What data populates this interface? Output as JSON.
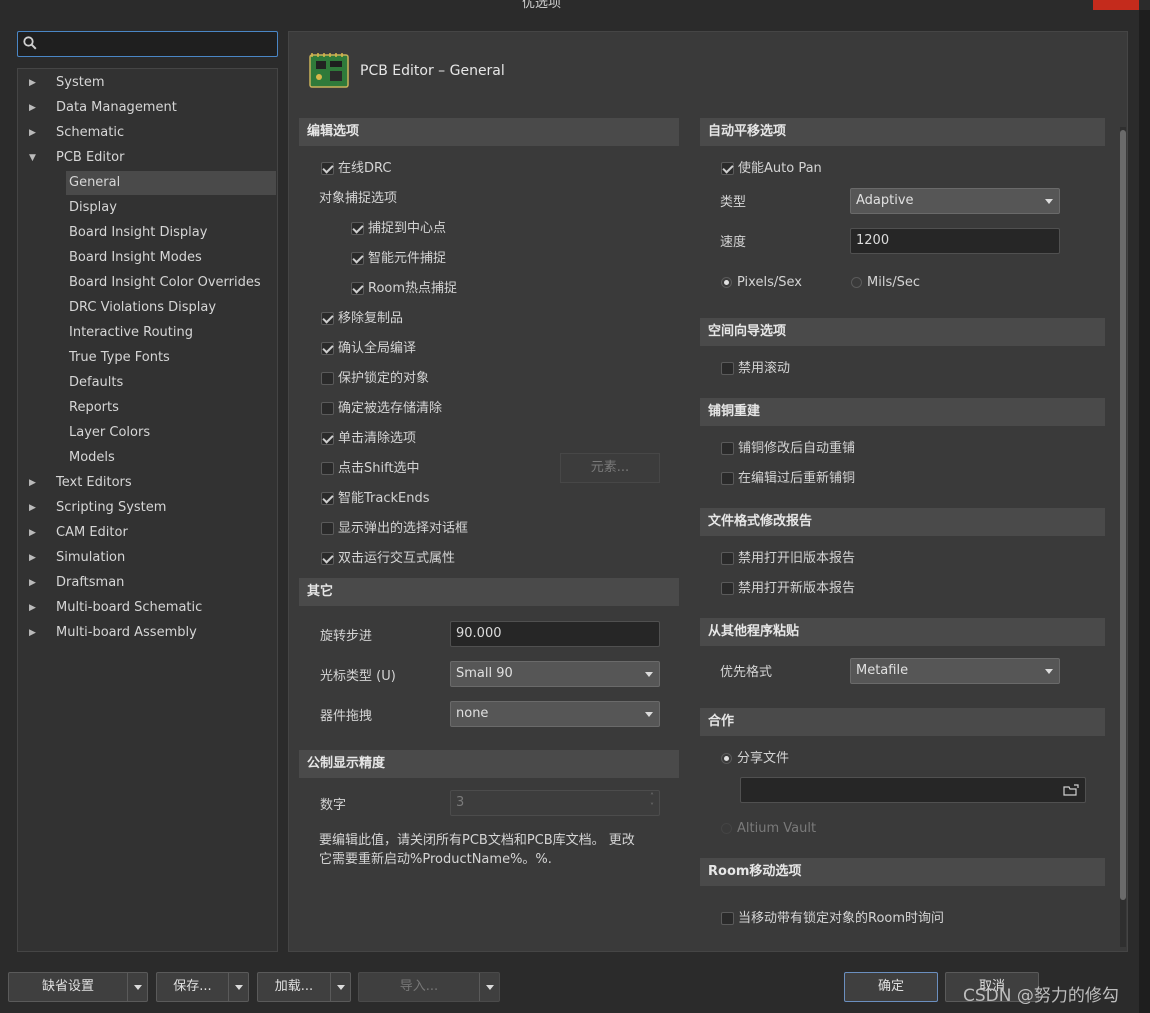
{
  "window": {
    "title": "优选项"
  },
  "search": {
    "placeholder": "",
    "value": ""
  },
  "tree": {
    "items": [
      {
        "label": "System"
      },
      {
        "label": "Data Management"
      },
      {
        "label": "Schematic"
      },
      {
        "label": "PCB Editor",
        "expanded": true
      }
    ],
    "pcb_children": [
      {
        "label": "General",
        "selected": true
      },
      {
        "label": "Display"
      },
      {
        "label": "Board Insight Display"
      },
      {
        "label": "Board Insight Modes"
      },
      {
        "label": "Board Insight Color Overrides"
      },
      {
        "label": "DRC Violations Display"
      },
      {
        "label": "Interactive Routing"
      },
      {
        "label": "True Type Fonts"
      },
      {
        "label": "Defaults"
      },
      {
        "label": "Reports"
      },
      {
        "label": "Layer Colors"
      },
      {
        "label": "Models"
      }
    ],
    "after_items": [
      {
        "label": "Text Editors"
      },
      {
        "label": "Scripting System"
      },
      {
        "label": "CAM Editor"
      },
      {
        "label": "Simulation"
      },
      {
        "label": "Draftsman"
      },
      {
        "label": "Multi-board Schematic"
      },
      {
        "label": "Multi-board Assembly"
      }
    ]
  },
  "page": {
    "title": "PCB Editor – General"
  },
  "edit_options": {
    "header": "编辑选项",
    "online_drc": {
      "label": "在线DRC",
      "checked": true
    },
    "snap_group_label": "对象捕捉选项",
    "snap_center": {
      "label": "捕捉到中心点",
      "checked": true
    },
    "smart_comp_snap": {
      "label": "智能元件捕捉",
      "checked": true
    },
    "room_hotspot": {
      "label": "Room热点捕捉",
      "checked": true
    },
    "remove_duplicates": {
      "label": "移除复制品",
      "checked": true
    },
    "confirm_global_edit": {
      "label": "确认全局编译",
      "checked": true
    },
    "protect_locked": {
      "label": "保护锁定的对象",
      "checked": false
    },
    "confirm_clear_memory": {
      "label": "确定被选存储清除",
      "checked": false
    },
    "click_clear_selection": {
      "label": "单击清除选项",
      "checked": true
    },
    "shift_click_select": {
      "label": "点击Shift选中",
      "checked": false
    },
    "elements_button": "元素...",
    "smart_track_ends": {
      "label": "智能TrackEnds",
      "checked": true
    },
    "show_popup_select": {
      "label": "显示弹出的选择对话框",
      "checked": false
    },
    "dblclick_inspector": {
      "label": "双击运行交互式属性",
      "checked": true
    }
  },
  "other": {
    "header": "其它",
    "rotation_step_label": "旋转步进",
    "rotation_step_value": "90.000",
    "cursor_type_label": "光标类型 (U)",
    "cursor_type_value": "Small 90",
    "comp_drag_label": "器件拖拽",
    "comp_drag_value": "none"
  },
  "metric_precision": {
    "header": "公制显示精度",
    "digits_label": "数字",
    "digits_value": "3",
    "note_line1": "要编辑此值，请关闭所有PCB文档和PCB库文档。 更改",
    "note_line2": "它需要重新启动%ProductName%。%."
  },
  "autopan": {
    "header": "自动平移选项",
    "enable": {
      "label": "使能Auto Pan",
      "checked": true
    },
    "type_label": "类型",
    "type_value": "Adaptive",
    "speed_label": "速度",
    "speed_value": "1200",
    "unit_pixels": {
      "label": "Pixels/Sex",
      "selected": true
    },
    "unit_mils": {
      "label": "Mils/Sec",
      "selected": false
    }
  },
  "space_nav": {
    "header": "空间向导选项",
    "disable_roll": {
      "label": "禁用滚动",
      "checked": false
    }
  },
  "polygon_rebuild": {
    "header": "铺铜重建",
    "auto_repour": {
      "label": "铺铜修改后自动重铺",
      "checked": false
    },
    "repour_after_edit": {
      "label": "在编辑过后重新铺铜",
      "checked": false
    }
  },
  "file_format": {
    "header": "文件格式修改报告",
    "disable_old": {
      "label": "禁用打开旧版本报告",
      "checked": false
    },
    "disable_new": {
      "label": "禁用打开新版本报告",
      "checked": false
    }
  },
  "paste": {
    "header": "从其他程序粘贴",
    "pref_format_label": "优先格式",
    "pref_format_value": "Metafile"
  },
  "collab": {
    "header": "合作",
    "share_files": {
      "label": "分享文件",
      "selected": true
    },
    "path_value": "",
    "altium_vault": {
      "label": "Altium Vault",
      "selected": false
    }
  },
  "room_move": {
    "header": "Room移动选项",
    "ask_locked": {
      "label": "当移动带有锁定对象的Room时询问",
      "checked": false
    }
  },
  "bottom": {
    "default_settings": "缺省设置",
    "save": "保存...",
    "load": "加载...",
    "import": "导入...",
    "ok": "确定",
    "cancel": "取消"
  },
  "watermark": "CSDN @努力的修勾",
  "colors": {
    "accent": "#4a86c5",
    "close": "#c42b1c",
    "panel": "#3a3a3a",
    "header": "#4a4a4a"
  }
}
